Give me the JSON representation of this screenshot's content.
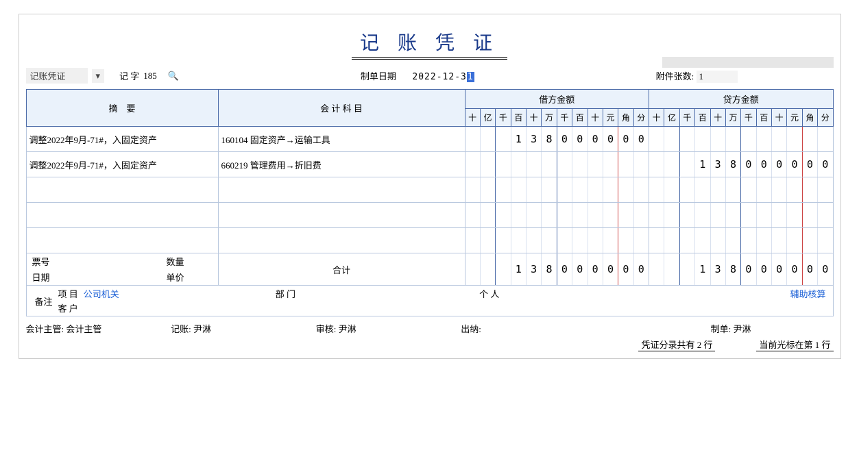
{
  "title": "记 账 凭 证",
  "info": {
    "type_label": "记账凭证",
    "no_prefix": "记 字",
    "no_value": "185",
    "date_label": "制单日期",
    "date_value_main": "2022-12-3",
    "date_value_cursor": "1",
    "attachments_label": "附件张数:",
    "attachments_value": "1"
  },
  "headers": {
    "summary": "摘　要",
    "account": "会 计 科 目",
    "debit": "借方金额",
    "credit": "贷方金额"
  },
  "units": [
    "十",
    "亿",
    "千",
    "百",
    "十",
    "万",
    "千",
    "百",
    "十",
    "元",
    "角",
    "分"
  ],
  "entries": [
    {
      "summary": "调整2022年9月-71#，入固定资产",
      "account": "160104 固定资产→运输工具",
      "debit": [
        "",
        "",
        "",
        "1",
        "3",
        "8",
        "0",
        "0",
        "0",
        "0",
        "0",
        "0"
      ],
      "credit": [
        "",
        "",
        "",
        "",
        "",
        "",
        "",
        "",
        "",
        "",
        "",
        ""
      ]
    },
    {
      "summary": "调整2022年9月-71#，入固定资产",
      "account": "660219 管理费用→折旧费",
      "debit": [
        "",
        "",
        "",
        "",
        "",
        "",
        "",
        "",
        "",
        "",
        "",
        ""
      ],
      "credit": [
        "",
        "",
        "",
        "1",
        "3",
        "8",
        "0",
        "0",
        "0",
        "0",
        "0",
        "0"
      ]
    },
    {
      "summary": "",
      "account": "",
      "debit": [
        "",
        "",
        "",
        "",
        "",
        "",
        "",
        "",
        "",
        "",
        "",
        ""
      ],
      "credit": [
        "",
        "",
        "",
        "",
        "",
        "",
        "",
        "",
        "",
        "",
        "",
        ""
      ]
    },
    {
      "summary": "",
      "account": "",
      "debit": [
        "",
        "",
        "",
        "",
        "",
        "",
        "",
        "",
        "",
        "",
        "",
        ""
      ],
      "credit": [
        "",
        "",
        "",
        "",
        "",
        "",
        "",
        "",
        "",
        "",
        "",
        ""
      ]
    },
    {
      "summary": "",
      "account": "",
      "debit": [
        "",
        "",
        "",
        "",
        "",
        "",
        "",
        "",
        "",
        "",
        "",
        ""
      ],
      "credit": [
        "",
        "",
        "",
        "",
        "",
        "",
        "",
        "",
        "",
        "",
        "",
        ""
      ]
    }
  ],
  "invoice": {
    "ticket_label": "票号",
    "date_label": "日期",
    "qty_label": "数量",
    "price_label": "单价",
    "total_label": "合计",
    "debit_total": [
      "",
      "",
      "",
      "1",
      "3",
      "8",
      "0",
      "0",
      "0",
      "0",
      "0",
      "0"
    ],
    "credit_total": [
      "",
      "",
      "",
      "1",
      "3",
      "8",
      "0",
      "0",
      "0",
      "0",
      "0",
      "0"
    ]
  },
  "remark": {
    "label": "备注",
    "project_label": "项 目",
    "project_value": "公司机关",
    "customer_label": "客 户",
    "dept_label": "部 门",
    "person_label": "个 人",
    "aux_link": "辅助核算"
  },
  "signers": {
    "supervisor_label": "会计主管:",
    "supervisor_value": "会计主管",
    "bookkeeper_label": "记账:",
    "bookkeeper_value": "尹淋",
    "reviewer_label": "审核:",
    "reviewer_value": "尹淋",
    "cashier_label": "出纳:",
    "cashier_value": "",
    "preparer_label": "制单:",
    "preparer_value": "尹淋"
  },
  "status": {
    "total_lines": "凭证分录共有 2 行",
    "cursor_line": "当前光标在第 1 行"
  }
}
